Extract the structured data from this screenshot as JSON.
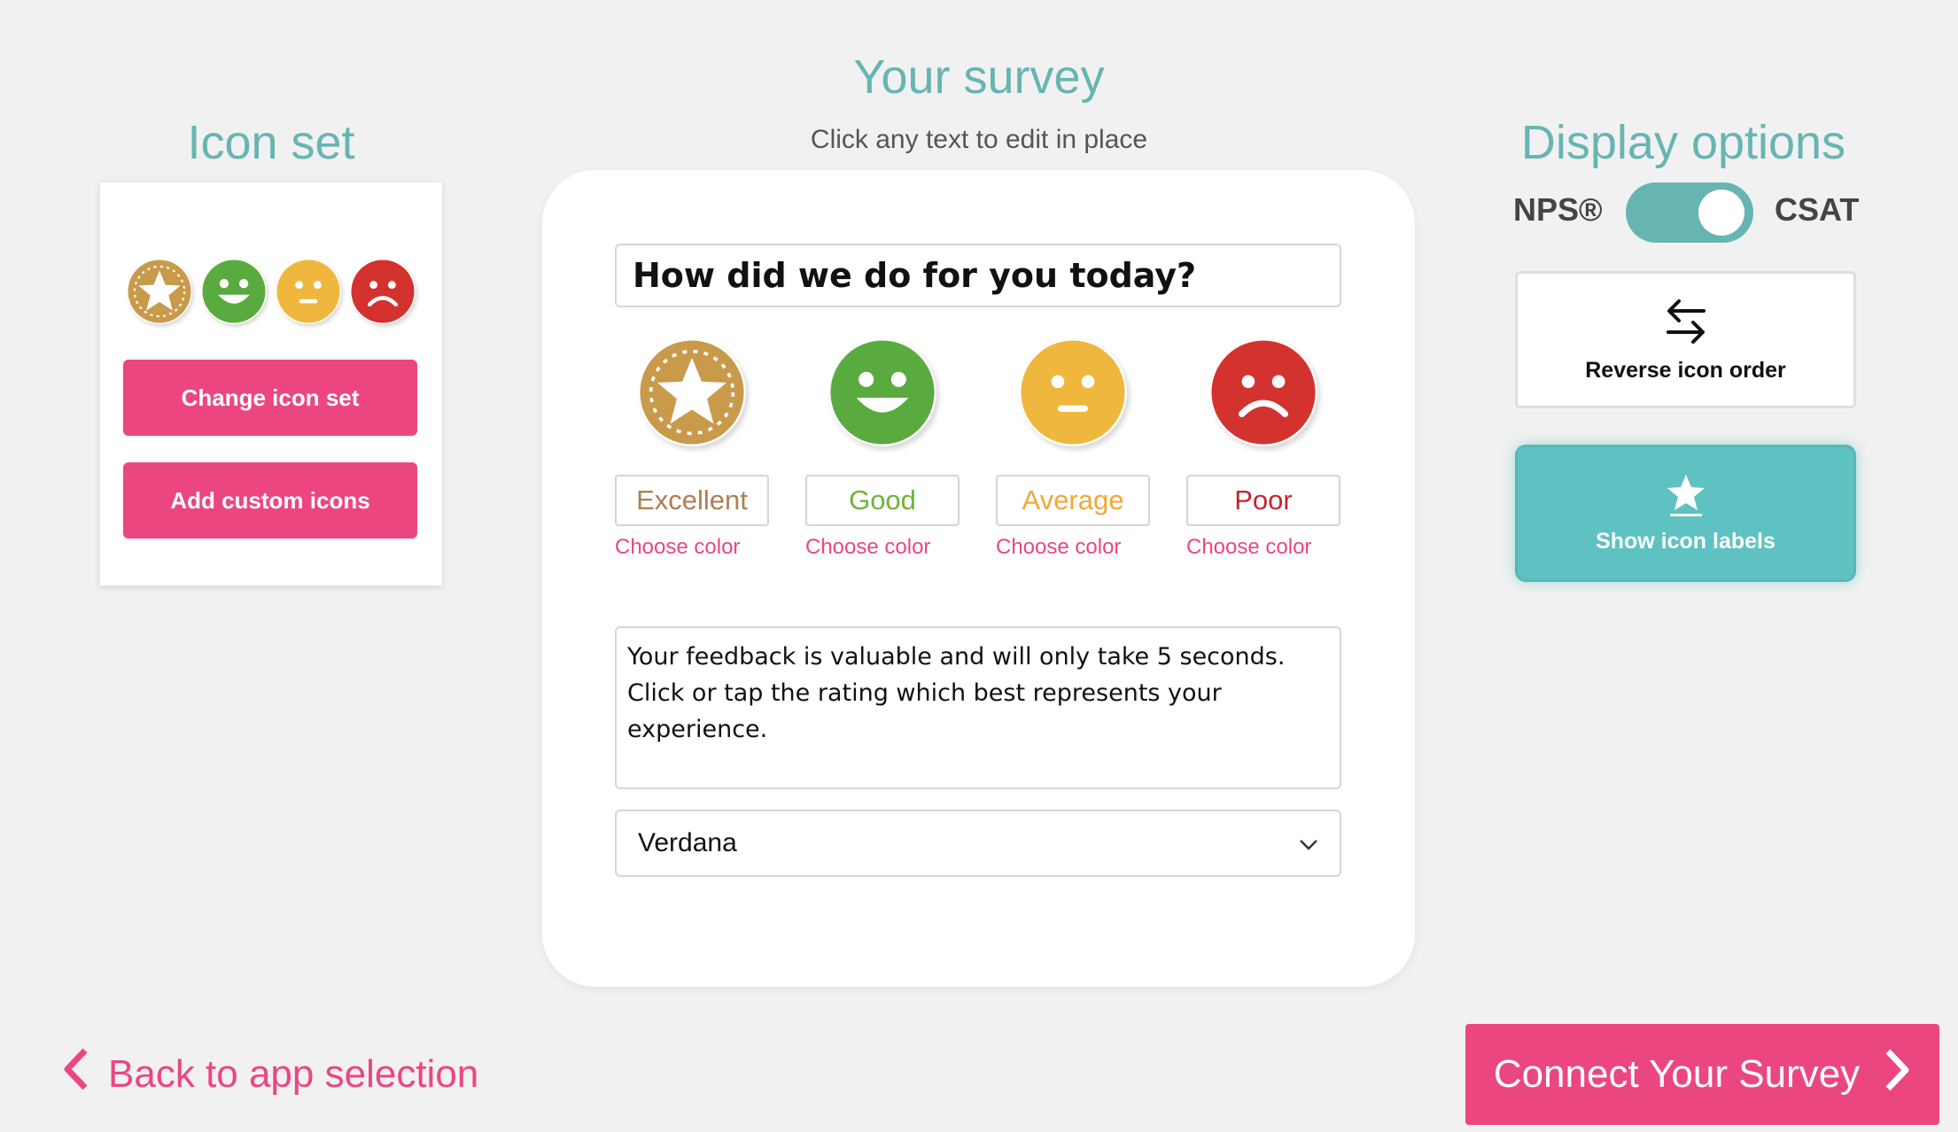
{
  "survey": {
    "title": "Your survey",
    "subtitle": "Click any text to edit in place",
    "question": "How did we do for you today?",
    "ratings": [
      {
        "icon": "star-face-icon",
        "label": "Excellent",
        "color": "#b07d52",
        "face_color": "#c99a4a",
        "choose_color": "Choose color"
      },
      {
        "icon": "smile-face-icon",
        "label": "Good",
        "color": "#6eb33a",
        "face_color": "#5aab3f",
        "choose_color": "Choose color"
      },
      {
        "icon": "neutral-face-icon",
        "label": "Average",
        "color": "#f0a836",
        "face_color": "#f0b73e",
        "choose_color": "Choose color"
      },
      {
        "icon": "frown-face-icon",
        "label": "Poor",
        "color": "#c0272d",
        "face_color": "#d4322e",
        "choose_color": "Choose color"
      }
    ],
    "description": "Your feedback is valuable and will only take 5 seconds. Click or tap the rating which best represents your experience.",
    "font": "Verdana"
  },
  "icon_set": {
    "title": "Icon set",
    "change_label": "Change icon set",
    "add_label": "Add custom icons"
  },
  "display_options": {
    "title": "Display options",
    "nps_label": "NPS®",
    "csat_label": "CSAT",
    "toggle_state": "CSAT",
    "reverse_label": "Reverse icon order",
    "show_labels_label": "Show icon labels"
  },
  "nav": {
    "back_label": "Back to app selection",
    "connect_label": "Connect Your Survey"
  },
  "colors": {
    "accent_pink": "#ec4681",
    "accent_teal": "#67b5b2",
    "background": "#f1f1f1"
  }
}
